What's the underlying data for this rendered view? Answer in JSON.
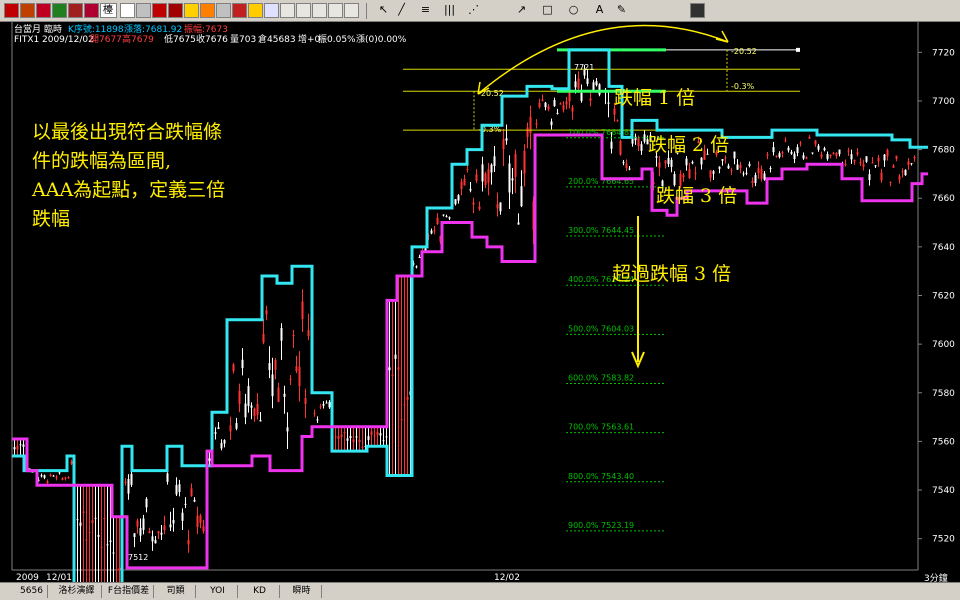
{
  "toolbar": {
    "combo_value": "檯",
    "icons": [
      "new-icon",
      "open-icon",
      "save-icon",
      "print-icon",
      "copy-icon",
      "paste-icon",
      "chart-icon",
      "watchlist-icon",
      "quote-icon",
      "news-icon",
      "alarm-icon",
      "edit-icon",
      "window-icon",
      "cursor-icon",
      "line-icon",
      "fibonacci-icon",
      "gann-icon",
      "channel-icon",
      "arrow-icon",
      "rectangle-icon",
      "ellipse-icon",
      "text-icon",
      "pen-icon",
      "marker-icon",
      "properties-icon",
      "layout-icon"
    ]
  },
  "header": {
    "line1": {
      "symbol": "台當月",
      "mode": "臨時",
      "k_count": "K序號:11898",
      "change": "漲落:7681.92",
      "range": "振幅:7673"
    },
    "line2": {
      "code": "FITX1",
      "date": "2009/12/02",
      "open": "開7677",
      "high": "高7679",
      "low": "低7675",
      "close": "收7676",
      "volume": "量703",
      "open_interest": "倉45683",
      "delta": "增+0",
      "amplitude": "振0.05%",
      "pct": "漲(0)0.00%"
    }
  },
  "colors": {
    "background": "#000000",
    "upper_band": "#33e6f0",
    "lower_band": "#ee33ee",
    "fib_line": "#d8d800",
    "fib_label": "#ffff66",
    "projection": "#00c000",
    "annotation": "#ffee00",
    "candle_up": "#ff3333",
    "candle_down": "#ffffff",
    "peak_green": "#33ff66"
  },
  "chart_data": {
    "type": "candlestick",
    "timeframe": "3分鐘",
    "ylim": [
      7510,
      7730
    ],
    "y_ticks": [
      7520,
      7540,
      7560,
      7580,
      7600,
      7620,
      7640,
      7660,
      7680,
      7700,
      7720
    ],
    "x_labels": [
      "2009",
      "12/01",
      "12/02"
    ],
    "bars": 300,
    "peak_label": "7721",
    "trough_label": "7512",
    "upper_band": [
      [
        0,
        7554
      ],
      [
        12,
        7554
      ],
      [
        12,
        7548
      ],
      [
        55,
        7548
      ],
      [
        55,
        7554
      ],
      [
        62,
        7554
      ],
      [
        62,
        7498
      ],
      [
        110,
        7498
      ],
      [
        110,
        7558
      ],
      [
        120,
        7558
      ],
      [
        120,
        7548
      ],
      [
        155,
        7548
      ],
      [
        155,
        7558
      ],
      [
        170,
        7558
      ],
      [
        170,
        7550
      ],
      [
        200,
        7550
      ],
      [
        200,
        7572
      ],
      [
        215,
        7572
      ],
      [
        215,
        7610
      ],
      [
        250,
        7610
      ],
      [
        250,
        7628
      ],
      [
        265,
        7628
      ],
      [
        265,
        7625
      ],
      [
        280,
        7625
      ],
      [
        280,
        7632
      ],
      [
        300,
        7632
      ],
      [
        300,
        7580
      ],
      [
        320,
        7580
      ],
      [
        320,
        7556
      ],
      [
        355,
        7556
      ],
      [
        355,
        7558
      ],
      [
        375,
        7558
      ],
      [
        375,
        7546
      ],
      [
        400,
        7546
      ],
      [
        400,
        7640
      ],
      [
        415,
        7640
      ],
      [
        415,
        7656
      ],
      [
        440,
        7656
      ],
      [
        440,
        7674
      ],
      [
        455,
        7674
      ],
      [
        455,
        7680
      ],
      [
        470,
        7680
      ],
      [
        470,
        7690
      ],
      [
        490,
        7690
      ],
      [
        490,
        7702
      ],
      [
        515,
        7702
      ],
      [
        515,
        7706
      ],
      [
        540,
        7706
      ],
      [
        540,
        7705
      ],
      [
        557,
        7705
      ],
      [
        557,
        7721
      ],
      [
        597,
        7721
      ],
      [
        597,
        7706
      ],
      [
        610,
        7706
      ],
      [
        610,
        7685
      ],
      [
        620,
        7685
      ],
      [
        620,
        7692
      ],
      [
        645,
        7692
      ],
      [
        645,
        7688
      ],
      [
        710,
        7688
      ],
      [
        710,
        7685
      ],
      [
        760,
        7685
      ],
      [
        760,
        7688
      ],
      [
        805,
        7688
      ],
      [
        805,
        7686
      ],
      [
        880,
        7686
      ],
      [
        880,
        7684
      ],
      [
        898,
        7684
      ],
      [
        898,
        7681
      ],
      [
        916,
        7681
      ]
    ],
    "lower_band": [
      [
        0,
        7561
      ],
      [
        15,
        7561
      ],
      [
        15,
        7548
      ],
      [
        25,
        7548
      ],
      [
        25,
        7542
      ],
      [
        100,
        7542
      ],
      [
        100,
        7529
      ],
      [
        115,
        7529
      ],
      [
        115,
        7508
      ],
      [
        195,
        7508
      ],
      [
        195,
        7556
      ],
      [
        200,
        7556
      ],
      [
        200,
        7550
      ],
      [
        240,
        7550
      ],
      [
        240,
        7554
      ],
      [
        258,
        7554
      ],
      [
        258,
        7548
      ],
      [
        290,
        7548
      ],
      [
        290,
        7562
      ],
      [
        300,
        7562
      ],
      [
        300,
        7566
      ],
      [
        375,
        7566
      ],
      [
        375,
        7618
      ],
      [
        385,
        7618
      ],
      [
        385,
        7628
      ],
      [
        410,
        7628
      ],
      [
        410,
        7638
      ],
      [
        430,
        7638
      ],
      [
        430,
        7650
      ],
      [
        460,
        7650
      ],
      [
        460,
        7644
      ],
      [
        475,
        7644
      ],
      [
        475,
        7640
      ],
      [
        490,
        7640
      ],
      [
        490,
        7634
      ],
      [
        523,
        7634
      ],
      [
        523,
        7686
      ],
      [
        590,
        7686
      ],
      [
        590,
        7668
      ],
      [
        630,
        7668
      ],
      [
        630,
        7672
      ],
      [
        640,
        7672
      ],
      [
        640,
        7655
      ],
      [
        655,
        7655
      ],
      [
        655,
        7653
      ],
      [
        665,
        7653
      ],
      [
        665,
        7660
      ],
      [
        675,
        7660
      ],
      [
        675,
        7663
      ],
      [
        735,
        7663
      ],
      [
        735,
        7658
      ],
      [
        755,
        7658
      ],
      [
        755,
        7668
      ],
      [
        770,
        7668
      ],
      [
        770,
        7672
      ],
      [
        795,
        7672
      ],
      [
        795,
        7674
      ],
      [
        830,
        7674
      ],
      [
        830,
        7668
      ],
      [
        850,
        7668
      ],
      [
        850,
        7659
      ],
      [
        900,
        7659
      ],
      [
        900,
        7666
      ],
      [
        910,
        7666
      ],
      [
        910,
        7670
      ],
      [
        916,
        7670
      ]
    ],
    "retracements": [
      {
        "label": "-20.52",
        "value": 7704
      },
      {
        "label": "-0.3%",
        "value": 7688
      },
      {
        "label": "100.0%",
        "value": 7684
      },
      {
        "label": "200.0%",
        "value": 7664
      },
      {
        "label": "300.0%",
        "value": 7644
      },
      {
        "label": "400.0%",
        "value": 7624
      },
      {
        "label": "500.0%",
        "value": 7604
      },
      {
        "label": "600.0%",
        "value": 7583
      },
      {
        "label": "700.0%",
        "value": 7563
      },
      {
        "label": "800.0%",
        "value": 7543
      },
      {
        "label": "900.0%",
        "value": 7523
      }
    ],
    "projection_labels": [
      {
        "level": "100.0%",
        "price": "7684.85",
        "value": 7684.85
      },
      {
        "level": "200.0%",
        "price": "7664.65",
        "value": 7664.65
      },
      {
        "level": "300.0%",
        "price": "7644.45",
        "value": 7644.45
      },
      {
        "level": "400.0%",
        "price": "7624.24",
        "value": 7624.24
      },
      {
        "level": "500.0%",
        "price": "7604.03",
        "value": 7604.03
      },
      {
        "level": "600.0%",
        "price": "7583.82",
        "value": 7583.82
      },
      {
        "level": "700.0%",
        "price": "7563.61",
        "value": 7563.61
      },
      {
        "level": "800.0%",
        "price": "7543.40",
        "value": 7543.4
      },
      {
        "level": "900.0%",
        "price": "7523.19",
        "value": 7523.19
      }
    ],
    "top_fib": {
      "left_label": "-20.52",
      "right_label": "-20.52",
      "sub_left": "-0.3%",
      "sub_right": "-0.3%"
    }
  },
  "annotations": {
    "note_lines": [
      "以最後出現符合跌幅條",
      "件的跌幅為區間,",
      "AAA為起點，定義三倍",
      "跌幅"
    ],
    "drop1": "跌幅 1 倍",
    "drop2": "跌幅 2 倍",
    "drop3": "跌幅 3 倍",
    "beyond": "超過跌幅 3 倍"
  },
  "bottom_tabs": [
    "5656",
    "洛杉演繹",
    "F台指價差",
    "司類",
    "YOI",
    "KD",
    "瞬時"
  ],
  "timeframe_label": "3分鐘"
}
